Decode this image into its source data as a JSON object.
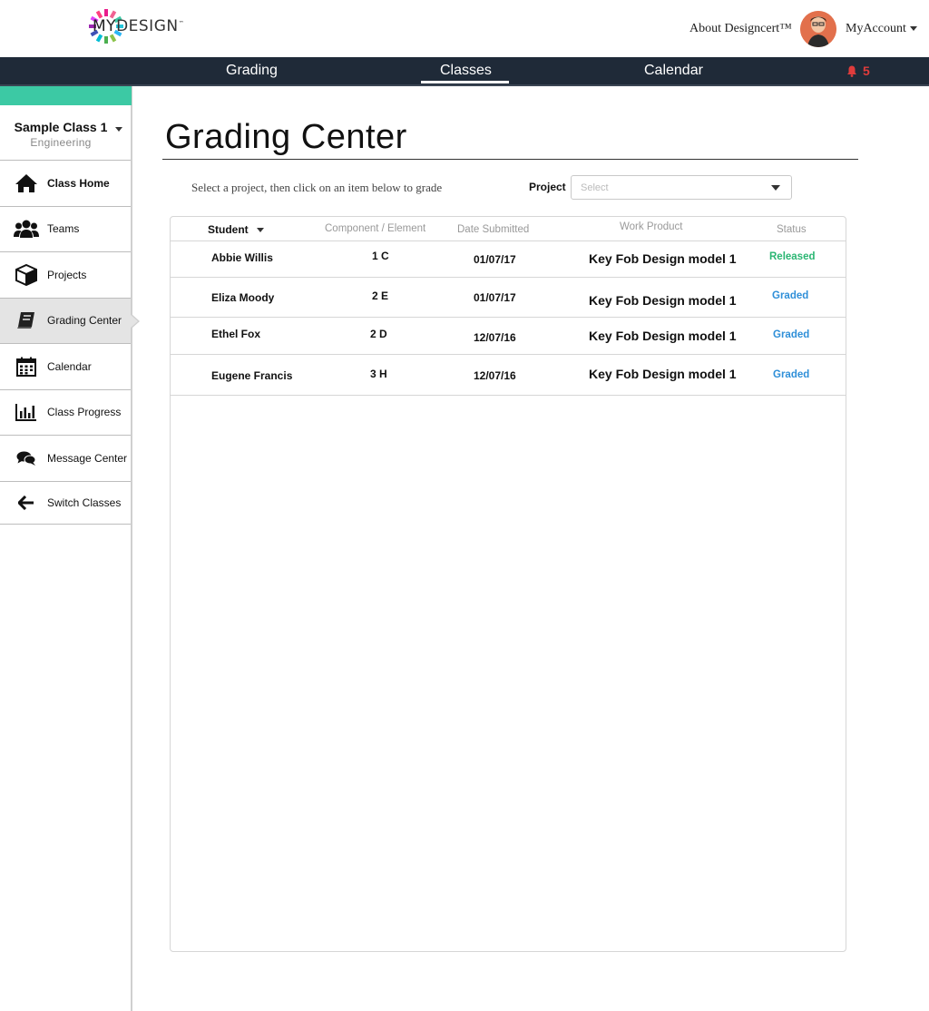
{
  "header": {
    "logo_my": "MY",
    "logo_design": "DESIGN",
    "logo_tm": "™",
    "about_label": "About Designcert™",
    "account_label": "MyAccount"
  },
  "nav": {
    "grading": "Grading",
    "classes": "Classes",
    "calendar": "Calendar",
    "notification_count": "5"
  },
  "sidebar": {
    "class_name": "Sample Class 1",
    "class_subject": "Engineering",
    "items": [
      {
        "label": "Class Home",
        "icon": "home-icon"
      },
      {
        "label": "Teams",
        "icon": "users-icon"
      },
      {
        "label": "Projects",
        "icon": "cube-icon"
      },
      {
        "label": "Grading Center",
        "icon": "book-icon",
        "active": true
      },
      {
        "label": "Calendar",
        "icon": "calendar-icon"
      },
      {
        "label": "Class Progress",
        "icon": "bar-chart-icon"
      },
      {
        "label": "Message Center",
        "icon": "chat-icon"
      },
      {
        "label": "Switch Classes",
        "icon": "arrow-left-icon"
      }
    ]
  },
  "main": {
    "title": "Grading Center",
    "instructions": "Select a project, then click on an item below to grade",
    "project_label": "Project",
    "project_placeholder": "Select"
  },
  "table": {
    "headers": {
      "student": "Student",
      "component": "Component / Element",
      "date": "Date Submitted",
      "work": "Work Product",
      "status": "Status"
    },
    "rows": [
      {
        "student": "Abbie Willis",
        "component": "1 C",
        "date": "01/07/17",
        "work": "Key Fob Design model 1",
        "status": "Released"
      },
      {
        "student": "Eliza Moody",
        "component": "2 E",
        "date": "01/07/17",
        "work": "Key Fob Design model 1",
        "status": "Graded"
      },
      {
        "student": "Ethel Fox",
        "component": "2 D",
        "date": "12/07/16",
        "work": "Key Fob Design model 1",
        "status": "Graded"
      },
      {
        "student": "Eugene Francis",
        "component": "3 H",
        "date": "12/07/16",
        "work": "Key Fob Design model 1",
        "status": "Graded"
      }
    ]
  },
  "colors": {
    "accent": "#3cc9a4",
    "navbar": "#1f2a38",
    "released": "#2bb673",
    "graded": "#2f8fd8",
    "notification": "#e03c3c"
  }
}
